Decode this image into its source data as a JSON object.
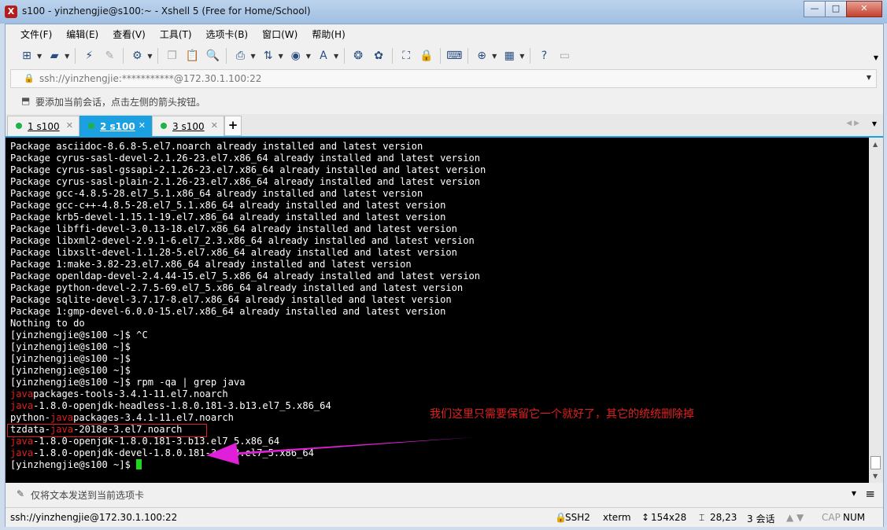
{
  "window": {
    "title": "s100 - yinzhengjie@s100:~ - Xshell 5 (Free for Home/School)",
    "app_icon": "xshell-logo",
    "buttons": [
      "minimize-icon",
      "maximize-icon",
      "close-icon"
    ]
  },
  "menu": [
    "文件(F)",
    "编辑(E)",
    "查看(V)",
    "工具(T)",
    "选项卡(B)",
    "窗口(W)",
    "帮助(H)"
  ],
  "address": {
    "text": "ssh://yinzhengjie:***********@172.30.1.100:22"
  },
  "hint": {
    "text": "要添加当前会话，点击左侧的箭头按钮。"
  },
  "tabs": [
    {
      "label": "1 s100",
      "active": false
    },
    {
      "label": "2 s100",
      "active": true
    },
    {
      "label": "3 s100",
      "active": false
    }
  ],
  "terminal": {
    "lines": [
      "Package asciidoc-8.6.8-5.el7.noarch already installed and latest version",
      "Package cyrus-sasl-devel-2.1.26-23.el7.x86_64 already installed and latest version",
      "Package cyrus-sasl-gssapi-2.1.26-23.el7.x86_64 already installed and latest version",
      "Package cyrus-sasl-plain-2.1.26-23.el7.x86_64 already installed and latest version",
      "Package gcc-4.8.5-28.el7_5.1.x86_64 already installed and latest version",
      "Package gcc-c++-4.8.5-28.el7_5.1.x86_64 already installed and latest version",
      "Package krb5-devel-1.15.1-19.el7.x86_64 already installed and latest version",
      "Package libffi-devel-3.0.13-18.el7.x86_64 already installed and latest version",
      "Package libxml2-devel-2.9.1-6.el7_2.3.x86_64 already installed and latest version",
      "Package libxslt-devel-1.1.28-5.el7.x86_64 already installed and latest version",
      "Package 1:make-3.82-23.el7.x86_64 already installed and latest version",
      "Package openldap-devel-2.4.44-15.el7_5.x86_64 already installed and latest version",
      "Package python-devel-2.7.5-69.el7_5.x86_64 already installed and latest version",
      "Package sqlite-devel-3.7.17-8.el7.x86_64 already installed and latest version",
      "Package 1:gmp-devel-6.0.0-15.el7.x86_64 already installed and latest version",
      "Nothing to do",
      "[yinzhengjie@s100 ~]$ ^C",
      "[yinzhengjie@s100 ~]$",
      "[yinzhengjie@s100 ~]$",
      "[yinzhengjie@s100 ~]$",
      "[yinzhengjie@s100 ~]$ rpm -qa | grep java"
    ],
    "grep_results": [
      {
        "pre": "",
        "match": "java",
        "post": "packages-tools-3.4.1-11.el7.noarch"
      },
      {
        "pre": "",
        "match": "java",
        "post": "-1.8.0-openjdk-headless-1.8.0.181-3.b13.el7_5.x86_64"
      },
      {
        "pre": "python-",
        "match": "java",
        "post": "packages-3.4.1-11.el7.noarch"
      },
      {
        "pre": "tzdata-",
        "match": "java",
        "post": "-2018e-3.el7.noarch"
      },
      {
        "pre": "",
        "match": "java",
        "post": "-1.8.0-openjdk-1.8.0.181-3.b13.el7_5.x86_64"
      },
      {
        "pre": "",
        "match": "java",
        "post": "-1.8.0-openjdk-devel-1.8.0.181-3.b13.el7_5.x86_64"
      }
    ],
    "prompt": "[yinzhengjie@s100 ~]$ ",
    "annotation": "我们这里只需要保留它一个就好了，其它的统统删除掉",
    "colors": {
      "background": "#000000",
      "text": "#ffffff",
      "match": "#e02020",
      "cursor": "#1ed81e",
      "arrow": "#e020d8"
    }
  },
  "compose": {
    "placeholder": "仅将文本发送到当前选项卡"
  },
  "status": {
    "connection": "ssh://yinzhengjie@172.30.1.100:22",
    "protocol": "SSH2",
    "term": "xterm",
    "size": "154x28",
    "cursor_pos": "28,23",
    "sessions": "3 会话",
    "cap": "CAP",
    "num": "NUM"
  }
}
